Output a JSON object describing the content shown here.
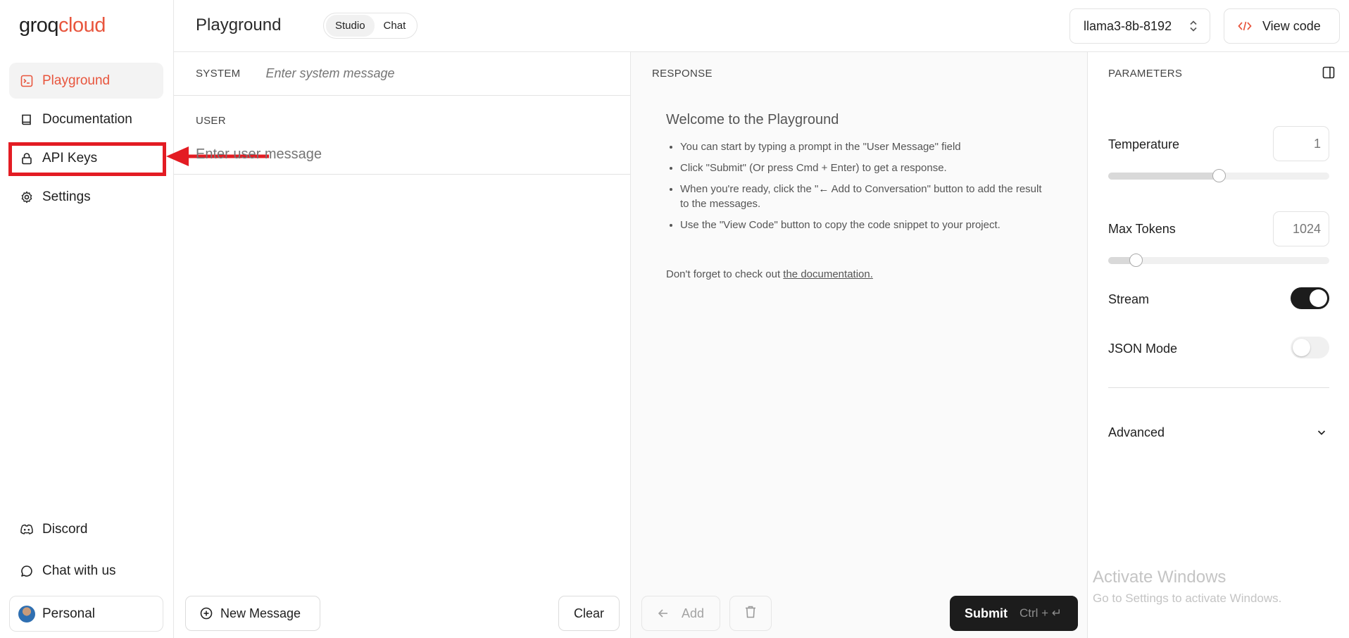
{
  "brand": {
    "name_main": "groq",
    "name_accent": "cloud",
    "accent_color": "#e8553d"
  },
  "sidebar": {
    "items": [
      {
        "label": "Playground",
        "icon": "terminal-icon",
        "active": true
      },
      {
        "label": "Documentation",
        "icon": "book-icon"
      },
      {
        "label": "API Keys",
        "icon": "lock-icon"
      },
      {
        "label": "Settings",
        "icon": "gear-icon"
      }
    ],
    "bottom": [
      {
        "label": "Discord",
        "icon": "discord-icon"
      },
      {
        "label": "Chat with us",
        "icon": "chat-bubble-icon"
      },
      {
        "label": "Personal",
        "icon": "avatar"
      }
    ],
    "annotation_color": "#e31c23"
  },
  "header": {
    "title": "Playground",
    "modes": [
      "Studio",
      "Chat"
    ],
    "active_mode": "Studio",
    "model": "llama3-8b-8192",
    "view_code": "View code"
  },
  "input": {
    "system_label": "SYSTEM",
    "system_placeholder": "Enter system message",
    "user_label": "USER",
    "user_placeholder": "Enter user message",
    "new_message": "New Message",
    "clear": "Clear"
  },
  "response": {
    "label": "RESPONSE",
    "welcome": "Welcome to the Playground",
    "tips": [
      "You can start by typing a prompt in the \"User Message\" field",
      "Click \"Submit\" (Or press Cmd + Enter) to get a response."
    ],
    "tip3_before": "When you're ready, click the \"",
    "tip3_after": " Add to Conversation\" button to add the result to the messages.",
    "tip4": "Use the \"View Code\" button to copy the code snippet to your project.",
    "doc_prefix": "Don't forget to check out ",
    "doc_link": "the documentation.",
    "add": "Add",
    "submit": "Submit",
    "submit_hint": "Ctrl + ↵"
  },
  "parameters": {
    "label": "PARAMETERS",
    "temperature": {
      "label": "Temperature",
      "value": "1",
      "fraction": 0.5
    },
    "max_tokens": {
      "label": "Max Tokens",
      "value": "1024",
      "fraction": 0.125
    },
    "stream": {
      "label": "Stream",
      "on": true
    },
    "json_mode": {
      "label": "JSON Mode",
      "on": false
    },
    "advanced": "Advanced"
  },
  "watermark": {
    "line1": "Activate Windows",
    "line2": "Go to Settings to activate Windows."
  }
}
